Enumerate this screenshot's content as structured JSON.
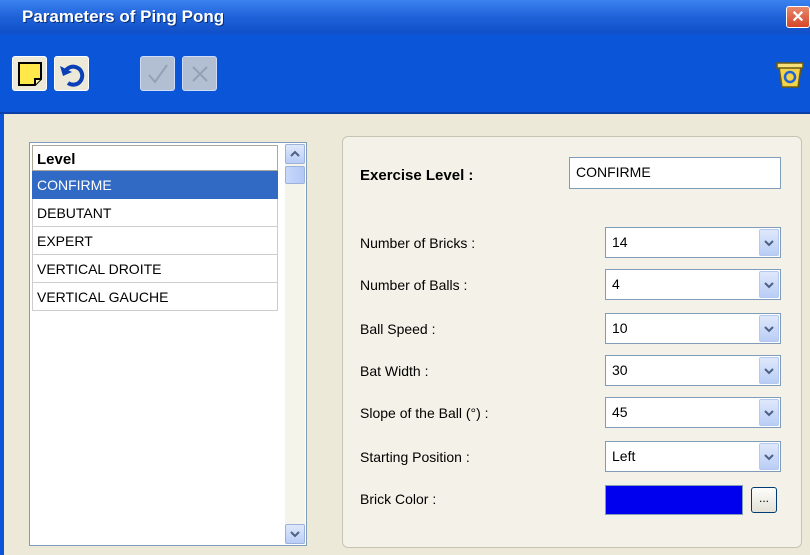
{
  "window": {
    "title": "Parameters of Ping Pong",
    "close_icon": "close-icon"
  },
  "toolbar": {
    "buttons": [
      {
        "icon": "new-note-icon",
        "enabled": true
      },
      {
        "icon": "undo-icon",
        "enabled": true
      },
      {
        "icon": "check-icon",
        "enabled": false
      },
      {
        "icon": "cancel-icon",
        "enabled": false
      },
      {
        "icon": "recycle-bin-icon",
        "enabled": true
      }
    ]
  },
  "levels": {
    "header": "Level",
    "items": [
      "CONFIRME",
      "DEBUTANT",
      "EXPERT",
      "VERTICAL DROITE",
      "VERTICAL GAUCHE"
    ],
    "selected": "CONFIRME"
  },
  "form": {
    "exercise_level_label": "Exercise Level :",
    "exercise_level_value": "CONFIRME",
    "fields": [
      {
        "label": "Number of Bricks :",
        "value": "14"
      },
      {
        "label": "Number of Balls :",
        "value": "4"
      },
      {
        "label": "Ball Speed :",
        "value": "10"
      },
      {
        "label": "Bat Width :",
        "value": "30"
      },
      {
        "label": "Slope of the Ball (°) :",
        "value": "45"
      },
      {
        "label": "Starting Position :",
        "value": "Left"
      }
    ],
    "brick_color_label": "Brick Color :",
    "brick_color": "#0000ee",
    "ellipsis_label": "..."
  },
  "colors": {
    "titlebar": "#1f62d8",
    "selection": "#316ac5",
    "panel": "#ece9d8"
  }
}
